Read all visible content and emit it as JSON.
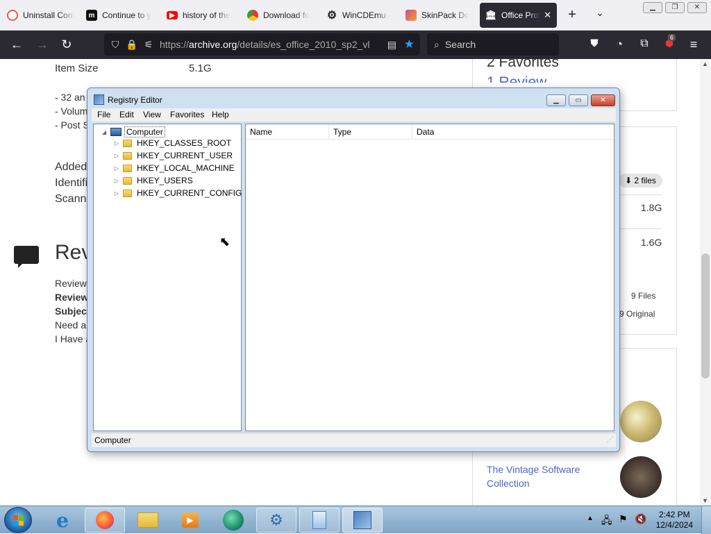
{
  "browser": {
    "tabs": [
      {
        "title": "Uninstall Com",
        "icon": "uninstall-favicon",
        "color": "#e05a5a"
      },
      {
        "title": "Continue to y",
        "icon": "m-favicon",
        "color": "#111111"
      },
      {
        "title": "history of the",
        "icon": "youtube-favicon",
        "color": "#ff0000"
      },
      {
        "title": "Download fo",
        "icon": "chrome-favicon",
        "color": "#3a9b3a"
      },
      {
        "title": "WinCDEmu -",
        "icon": "gear-favicon",
        "color": "#222222"
      },
      {
        "title": "SkinPack Do",
        "icon": "skinpack-favicon",
        "color": "#d04a8a"
      },
      {
        "title": "Office Prof",
        "icon": "archive-favicon",
        "color": "#ffffff",
        "active": true
      }
    ],
    "url_prefix": "https://",
    "url_domain": "archive.org",
    "url_path": "/details/es_office_2010_sp2_vl",
    "search_placeholder": "Search",
    "extension_badge": "6"
  },
  "page": {
    "item_size_label": "Item Size",
    "item_size_value": "5.1G",
    "bullets": [
      "- 32 an",
      "- Volum",
      "- Post S"
    ],
    "meta_lines": [
      "Added",
      "Identifi",
      "Scann"
    ],
    "reviews_heading": "Rev",
    "review_lines": [
      "Review",
      "Review",
      "Subjec",
      "Need a",
      "I Have a"
    ],
    "favorites": "2 Favorites",
    "review_count": "1 Review",
    "files_button": "2 files",
    "size1": "1.8G",
    "size2": "1.6G",
    "files_count": "9 Files",
    "original": "9 Original",
    "collection": "The Vintage Software Collection"
  },
  "regedit": {
    "title": "Registry Editor",
    "menu": [
      "File",
      "Edit",
      "View",
      "Favorites",
      "Help"
    ],
    "root": "Computer",
    "hives": [
      "HKEY_CLASSES_ROOT",
      "HKEY_CURRENT_USER",
      "HKEY_LOCAL_MACHINE",
      "HKEY_USERS",
      "HKEY_CURRENT_CONFIG"
    ],
    "columns": [
      "Name",
      "Type",
      "Data"
    ],
    "status": "Computer"
  },
  "taskbar": {
    "time": "2:42 PM",
    "date": "12/4/2024"
  }
}
